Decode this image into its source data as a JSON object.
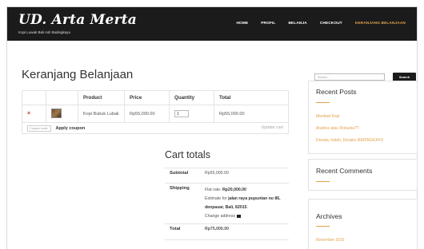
{
  "header": {
    "logo": "UD. Arta Merta",
    "tagline": "Kopi Luwak Bali Asli Badingkayu",
    "nav": [
      {
        "label": "HOME",
        "active": false
      },
      {
        "label": "PROFIL",
        "active": false
      },
      {
        "label": "BELANJA",
        "active": false
      },
      {
        "label": "CHECKOUT",
        "active": false
      },
      {
        "label": "KERANJANG BELANJAAN",
        "active": true
      }
    ]
  },
  "page": {
    "title": "Keranjang Belanjaan"
  },
  "cart": {
    "headers": {
      "product": "Product",
      "price": "Price",
      "quantity": "Quantity",
      "total": "Total"
    },
    "items": [
      {
        "remove_icon": "×",
        "product_name": "Kopi Bubuk Lubak",
        "price": "Rp55,000.00",
        "quantity": "1",
        "total": "Rp55,000.00"
      }
    ],
    "coupon_placeholder": "Coupon code",
    "apply_label": "Apply coupon",
    "update_label": "Update cart"
  },
  "totals": {
    "title": "Cart totals",
    "subtotal_label": "Subtotal",
    "subtotal_value": "Rp55,000.00",
    "shipping_label": "Shipping",
    "shipping_rate_prefix": "Flat rate:",
    "shipping_rate_value": "Rp20,000.00",
    "estimate_prefix": "Estimate for",
    "estimate_address": "jalan raya pupuntan no 86, denpasar, Bali, 82015",
    "change_address_label": "Change address",
    "total_label": "Total",
    "total_value": "Rp75,000.00"
  },
  "sidebar": {
    "search_placeholder": "Search...",
    "search_button": "Search",
    "recent_posts_title": "Recent Posts",
    "recent_posts": [
      "Manfaat Kopi",
      "Arabica atau Robusta??",
      "Desaku Indah, Desaku BADINGKAYU"
    ],
    "recent_comments_title": "Recent Comments",
    "archives_title": "Archives",
    "archives": [
      "November 2016"
    ]
  },
  "colors": {
    "header_bg": "#1b1b1b",
    "accent": "#e2a24c",
    "remove": "#d03030"
  }
}
